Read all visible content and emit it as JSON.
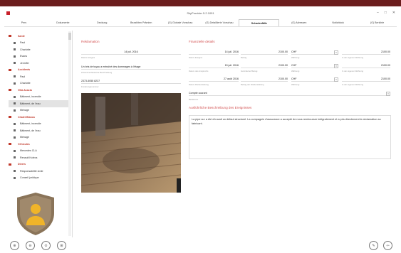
{
  "window": {
    "title": "SkyProvider 5.2.1001",
    "controls": [
      "–",
      "□",
      "✕"
    ]
  },
  "tabs": [
    {
      "label": "Pers",
      "active": false
    },
    {
      "label": "Dokumente",
      "active": false
    },
    {
      "label": "Deckung",
      "active": false
    },
    {
      "label": "Bezahlten Prämien",
      "active": false
    },
    {
      "label": "(G) Globale Vorschau",
      "active": false
    },
    {
      "label": "(G) Detaillierte Vorschau",
      "active": false
    },
    {
      "label": "Schadenfälle",
      "active": true
    },
    {
      "label": "(G) Adressen",
      "active": false
    },
    {
      "label": "Notizblock",
      "active": false
    },
    {
      "label": "(G) Berichte",
      "active": false
    }
  ],
  "tree": [
    {
      "label": "Santé",
      "type": "cat"
    },
    {
      "label": "Paul",
      "type": "item"
    },
    {
      "label": "Charlotte",
      "type": "item"
    },
    {
      "label": "Evans",
      "type": "item"
    },
    {
      "label": "Jennifer",
      "type": "item"
    },
    {
      "label": "Accidents",
      "type": "cat"
    },
    {
      "label": "Paul",
      "type": "item"
    },
    {
      "label": "Charlotte",
      "type": "item"
    },
    {
      "label": "Villa Acacia",
      "type": "cat"
    },
    {
      "label": "Bâtiment, incendie",
      "type": "item"
    },
    {
      "label": "Bâtiment, de l'eau",
      "type": "item",
      "selected": true
    },
    {
      "label": "Ménage",
      "type": "item"
    },
    {
      "label": "Chalet Blanca",
      "type": "cat"
    },
    {
      "label": "Bâtiment, incendie",
      "type": "item"
    },
    {
      "label": "Bâtiment, de l'eau",
      "type": "item"
    },
    {
      "label": "Ménage",
      "type": "item"
    },
    {
      "label": "Véhicules",
      "type": "cat"
    },
    {
      "label": "Mercedes CLA",
      "type": "item"
    },
    {
      "label": "Renault Koleos",
      "type": "item"
    },
    {
      "label": "Divers",
      "type": "cat"
    },
    {
      "label": "Responsabilité civile",
      "type": "item"
    },
    {
      "label": "Conseil juridique",
      "type": "item"
    }
  ],
  "claim": {
    "section_title": "Reklamation",
    "date": "14 juil. 2016",
    "date_label": "Datum Ereignis",
    "description": "Un bris de tuyau a entraîné des dommages à l'étage",
    "description_label": "Zusammenfassende Beschreibung",
    "reference": "2373-5055 8237",
    "reference_label": "Forderungsnummer"
  },
  "finance": {
    "section_title": "Finanzielle details",
    "rows": [
      {
        "date": "14 juil. 2016",
        "amount": "2100.00",
        "currency": "CHF",
        "total": "2100.00",
        "date_label": "Datum Ereignis",
        "amount_label": "Betrag",
        "currency_label": "Währung",
        "total_label": "In der eigenen Währung"
      },
      {
        "date": "15 juil. 2016",
        "amount": "2100.00",
        "currency": "CHF",
        "total": "2100.00",
        "date_label": "Datum des Anspruchs",
        "amount_label": "Geforderter Betrag",
        "currency_label": "Währung",
        "total_label": "In der eigenen Währung"
      },
      {
        "date": "27 août 2016",
        "amount": "2100.00",
        "currency": "CHF",
        "total": "2100.00",
        "date_label": "Datum Rückerstattung",
        "amount_label": "Betrag der Rückerstattung",
        "currency_label": "Währung",
        "total_label": "In der eigenen Währung"
      }
    ],
    "account": "Compte courant",
    "account_label": "Bankkonto"
  },
  "details": {
    "section_title": "Ausführliche Beschreibung des Ereignisses",
    "text": "La pipe sur a été dû avait un défaut structurel. La compagnie d'assurance a accepté de nous rembourser intégralement et a pris directement la réclamation au fabricant."
  },
  "footer": {
    "left_buttons": [
      "⊕",
      "⊖",
      "⊙",
      "⊞"
    ],
    "right_buttons": [
      "✎",
      "⇦"
    ]
  },
  "colors": {
    "accent": "#c0392b",
    "topband": "#6b1d1d"
  }
}
